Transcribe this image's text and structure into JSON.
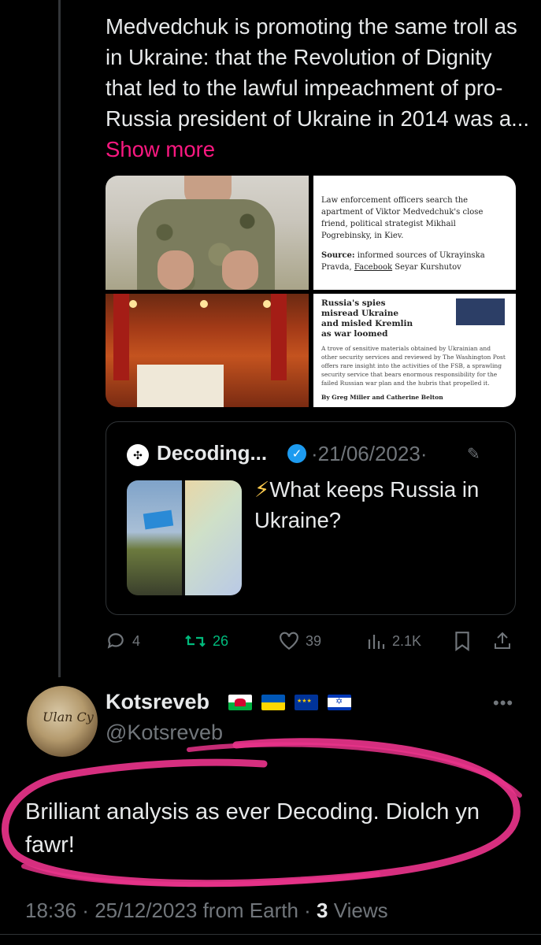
{
  "post": {
    "text": "Medvedchuk is promoting the same troll as in Ukraine: that the Revolution of Dignity that led to the lawful impeachment of pro-Russia president of Ukraine in 2014 was a...",
    "show_more": "Show more",
    "media": {
      "tile2_caption": "Law enforcement officers search the apartment of Viktor Medvedchuk's close friend, political strategist Mikhail Pogrebinsky, in Kiev.",
      "tile2_source_label": "Source:",
      "tile2_source_text": "informed sources of Ukrayinska Pravda,",
      "tile2_source_link": "Facebook",
      "tile2_source_tail": "Seyar Kurshutov",
      "tile4_headline": "Russia's spies misread Ukraine and misled Kremlin as war loomed",
      "tile4_body": "A trove of sensitive materials obtained by Ukrainian and other security services and reviewed by The Washington Post offers rare insight into the activities of the FSB, a sprawling security service that bears enormous responsibility for the failed Russian war plan and the hubris that propelled it.",
      "tile4_byline": "By Greg Miller and Catherine Belton"
    },
    "quote": {
      "author": "Decoding...",
      "date": "21/06/2023",
      "text": "What keeps Russia in Ukraine?"
    },
    "actions": {
      "replies": "4",
      "reposts": "26",
      "likes": "39",
      "views": "2.1K"
    }
  },
  "reply": {
    "name": "Kotsreveb",
    "handle": "@Kotsreveb",
    "text": "Brilliant analysis as ever Decoding. Diolch yn fawr!",
    "time": "18:36",
    "date": "25/12/2023",
    "source": "from Earth",
    "views_count": "3",
    "views_label": "Views",
    "flags": [
      "wales-flag",
      "ukraine-flag",
      "eu-flag",
      "israel-flag"
    ]
  },
  "colors": {
    "background": "#000000",
    "text": "#e7e9ea",
    "muted": "#71767b",
    "accent_pink": "#f91880",
    "repost_green": "#00ba7c",
    "verified_blue": "#1d9bf0",
    "highlight_stroke": "#e8338a"
  }
}
